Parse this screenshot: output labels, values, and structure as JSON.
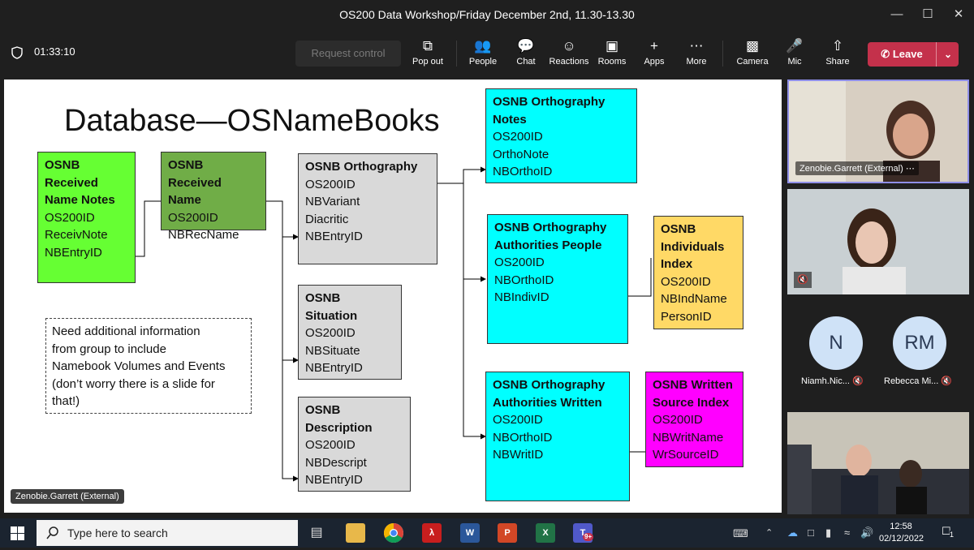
{
  "window": {
    "title": "OS200 Data Workshop/Friday December 2nd, 11.30-13.30"
  },
  "meeting": {
    "timer": "01:33:10",
    "request_control": "Request control",
    "buttons": [
      {
        "label": "Pop out",
        "icon": "pop-out-icon"
      },
      {
        "label": "People",
        "icon": "people-icon"
      },
      {
        "label": "Chat",
        "icon": "chat-icon"
      },
      {
        "label": "Reactions",
        "icon": "reactions-icon"
      },
      {
        "label": "Rooms",
        "icon": "rooms-icon"
      },
      {
        "label": "Apps",
        "icon": "apps-icon"
      },
      {
        "label": "More",
        "icon": "more-icon"
      },
      {
        "label": "Camera",
        "icon": "camera-icon"
      },
      {
        "label": "Mic",
        "icon": "mic-icon"
      },
      {
        "label": "Share",
        "icon": "share-icon"
      }
    ],
    "leave_label": "Leave",
    "leave_color": "#c4314b"
  },
  "slide": {
    "title": "Database—OSNameBooks",
    "boxes": [
      {
        "id": "received-notes",
        "header": [
          "OSNB",
          "Received",
          "Name Notes"
        ],
        "fields": [
          "OS200ID",
          "ReceivNote",
          "NBEntryID"
        ],
        "color": "#66ff33"
      },
      {
        "id": "received-name",
        "header": [
          "OSNB Received",
          "Name"
        ],
        "fields": [
          "OS200ID",
          "NBRecName"
        ],
        "color": "#70ad47"
      },
      {
        "id": "orthography",
        "header": [
          "OSNB Orthography"
        ],
        "fields": [
          "OS200ID",
          "NBVariant",
          "Diacritic",
          "NBEntryID"
        ],
        "color": "#d9d9d9"
      },
      {
        "id": "situation",
        "header": [
          "OSNB",
          "Situation"
        ],
        "fields": [
          "OS200ID",
          "NBSituate",
          "NBEntryID"
        ],
        "color": "#d9d9d9"
      },
      {
        "id": "description",
        "header": [
          "OSNB",
          "Description"
        ],
        "fields": [
          "OS200ID",
          "NBDescript",
          "NBEntryID"
        ],
        "color": "#d9d9d9"
      },
      {
        "id": "orthography-notes",
        "header": [
          "OSNB Orthography",
          "Notes"
        ],
        "fields": [
          "OS200ID",
          "OrthoNote",
          "NBOrthoID"
        ],
        "color": "#00ffff"
      },
      {
        "id": "authorities-people",
        "header": [
          "OSNB Orthography",
          "Authorities People"
        ],
        "fields": [
          "OS200ID",
          "NBOrthoID",
          "NBIndivID"
        ],
        "color": "#00ffff"
      },
      {
        "id": "individuals-index",
        "header": [
          "OSNB",
          "Individuals",
          "Index"
        ],
        "fields": [
          "OS200ID",
          "NBIndName",
          "PersonID"
        ],
        "color": "#ffd966"
      },
      {
        "id": "authorities-written",
        "header": [
          "OSNB Orthography",
          "Authorities Written"
        ],
        "fields": [
          "OS200ID",
          "NBOrthoID",
          "NBWritID"
        ],
        "color": "#00ffff"
      },
      {
        "id": "written-source-index",
        "header": [
          "OSNB Written",
          "Source Index"
        ],
        "fields": [
          "OS200ID",
          "NBWritName",
          "WrSourceID"
        ],
        "color": "#ff00ff"
      }
    ],
    "note_lines": [
      "Need additional information",
      "from group to include",
      "Namebook Volumes and Events",
      "(don’t worry there is a slide for",
      "that!)"
    ],
    "presenter_tag": "Zenobie.Garrett (External)"
  },
  "participants": {
    "tile1_name": "Zenobie.Garrett (External)",
    "tile1_more": "⋯",
    "avatars": [
      {
        "initials": "N",
        "name": "Niamh.Nic..."
      },
      {
        "initials": "RM",
        "name": "Rebecca Mi..."
      }
    ]
  },
  "taskbar": {
    "search_placeholder": "Type here to search",
    "time": "12:58",
    "date": "02/12/2022",
    "notification_count": "1",
    "teams_badge": "9+"
  }
}
